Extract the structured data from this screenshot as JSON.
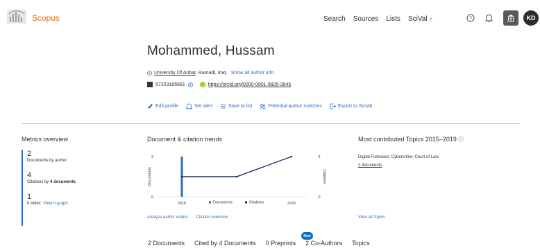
{
  "header": {
    "brand": "Scopus",
    "nav": [
      {
        "label": "Search"
      },
      {
        "label": "Sources"
      },
      {
        "label": "Lists"
      },
      {
        "label": "SciVal"
      }
    ],
    "external_glyph": "↗",
    "avatar_initials": "KD",
    "icons": [
      "elsevier-logo",
      "help-icon",
      "bell-icon",
      "institution-icon"
    ]
  },
  "profile": {
    "name": "Mohammed, Hussam",
    "affiliation": "University Of Anbar",
    "location": ", Ramadi, Iraq",
    "show_all_info": "Show all author info",
    "author_id": "57203165661",
    "orcid": "https://orcid.org/0000-0001-9925-3945",
    "actions": [
      {
        "label": "Edit profile",
        "icon": "pencil-icon"
      },
      {
        "label": "Set alert",
        "icon": "bell-icon"
      },
      {
        "label": "Save to list",
        "icon": "list-icon"
      },
      {
        "label": "Potential author matches",
        "icon": "people-icon"
      },
      {
        "label": "Export to SciVal",
        "icon": "export-icon"
      }
    ]
  },
  "metrics": {
    "title": "Metrics overview",
    "items": [
      {
        "value": "2",
        "label": "Documents by author"
      },
      {
        "value": "4",
        "label_prefix": "Citations by ",
        "label_bold": "4 documents"
      },
      {
        "value": "1",
        "label": "h-index:",
        "link": "View h-graph"
      }
    ]
  },
  "trends": {
    "title": "Document & citation trends",
    "links": [
      "Analyze author output",
      "Citation overview"
    ]
  },
  "chart_data": {
    "type": "bar",
    "x_ticks": [
      "2018",
      "2020"
    ],
    "categories": [
      "2018",
      "2019",
      "2020"
    ],
    "series": [
      {
        "name": "Documents",
        "type": "bar",
        "axis": "left",
        "color": "#2e6bc6",
        "values": [
          2,
          0,
          0
        ]
      },
      {
        "name": "Citations",
        "type": "line",
        "axis": "right",
        "color": "#1f2a5c",
        "values": [
          1,
          1,
          2
        ]
      }
    ],
    "ylabel": "Documents",
    "y2label": "Citations",
    "ylim": [
      0,
      2
    ],
    "y2lim": [
      0,
      2
    ],
    "y_ticks": [
      "0",
      "2"
    ],
    "y2_ticks": [
      "0",
      "2"
    ],
    "legend": "bottom"
  },
  "topics": {
    "title": "Most contributed Topics 2015–2019",
    "info_glyph": "ⓘ",
    "topic": "Digital Forensics; Cybercrime; Court of Law",
    "docs": "2 documents",
    "view_all": "View all Topics"
  },
  "tabs": [
    {
      "label": "2 Documents"
    },
    {
      "label": "Cited by 4 Documents"
    },
    {
      "label": "0 Preprints",
      "badge": "New"
    },
    {
      "label": "2 Co-Authors"
    },
    {
      "label": "Topics"
    }
  ]
}
